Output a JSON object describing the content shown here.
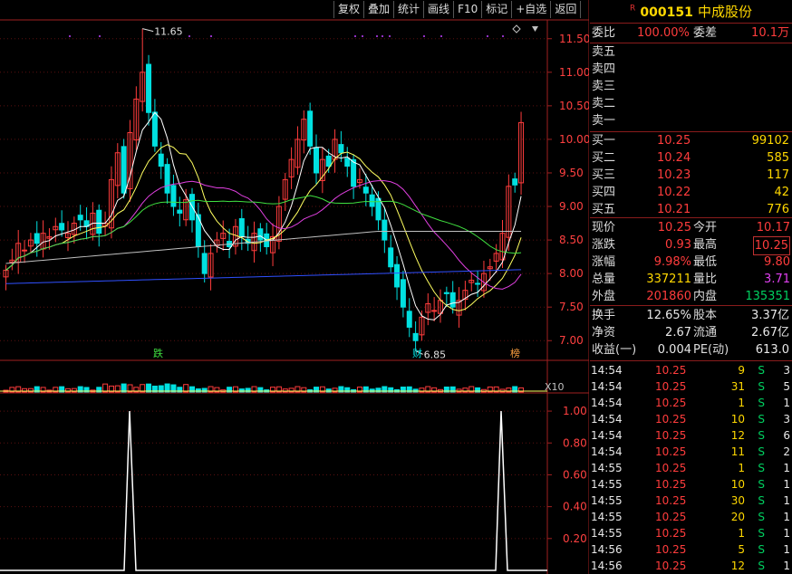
{
  "toolbar": {
    "buttons": [
      "复权",
      "叠加",
      "统计",
      "画线",
      "F10",
      "标记",
      "+自选",
      "返回"
    ]
  },
  "stock": {
    "flag": "R",
    "code": "000151",
    "name": "中成股份"
  },
  "weibi": {
    "label": "委比",
    "value": "100.00%",
    "label2": "委差",
    "value2": "10.1万"
  },
  "asks": [
    {
      "label": "卖五"
    },
    {
      "label": "卖四"
    },
    {
      "label": "卖三"
    },
    {
      "label": "卖二"
    },
    {
      "label": "卖一"
    }
  ],
  "bids": [
    {
      "label": "买一",
      "price": "10.25",
      "vol": "99102"
    },
    {
      "label": "买二",
      "price": "10.24",
      "vol": "585"
    },
    {
      "label": "买三",
      "price": "10.23",
      "vol": "117"
    },
    {
      "label": "买四",
      "price": "10.22",
      "vol": "42"
    },
    {
      "label": "买五",
      "price": "10.21",
      "vol": "776"
    }
  ],
  "quote": [
    {
      "l1": "现价",
      "v1": "10.25",
      "l2": "今开",
      "v2": "10.17"
    },
    {
      "l1": "涨跌",
      "v1": "0.93",
      "l2": "最高",
      "v2": "10.25"
    },
    {
      "l1": "涨幅",
      "v1": "9.98%",
      "l2": "最低",
      "v2": "9.80"
    },
    {
      "l1": "总量",
      "v1": "337211",
      "l2": "量比",
      "v2": "3.71"
    },
    {
      "l1": "外盘",
      "v1": "201860",
      "l2": "内盘",
      "v2": "135351"
    }
  ],
  "fund": [
    {
      "l1": "换手",
      "v1": "12.65%",
      "l2": "股本",
      "v2": "3.37亿"
    },
    {
      "l1": "净资",
      "v1": "2.67",
      "l2": "流通",
      "v2": "2.67亿"
    },
    {
      "l1": "收益(一)",
      "v1": "0.004",
      "l2": "PE(动)",
      "v2": "613.0"
    }
  ],
  "ticks": [
    {
      "time": "14:54",
      "price": "10.25",
      "vol": "9",
      "side": "S",
      "n": "3"
    },
    {
      "time": "14:54",
      "price": "10.25",
      "vol": "31",
      "side": "S",
      "n": "5"
    },
    {
      "time": "14:54",
      "price": "10.25",
      "vol": "1",
      "side": "S",
      "n": "1"
    },
    {
      "time": "14:54",
      "price": "10.25",
      "vol": "10",
      "side": "S",
      "n": "3"
    },
    {
      "time": "14:54",
      "price": "10.25",
      "vol": "12",
      "side": "S",
      "n": "6"
    },
    {
      "time": "14:54",
      "price": "10.25",
      "vol": "11",
      "side": "S",
      "n": "2"
    },
    {
      "time": "14:55",
      "price": "10.25",
      "vol": "1",
      "side": "S",
      "n": "1"
    },
    {
      "time": "14:55",
      "price": "10.25",
      "vol": "10",
      "side": "S",
      "n": "1"
    },
    {
      "time": "14:55",
      "price": "10.25",
      "vol": "30",
      "side": "S",
      "n": "1"
    },
    {
      "time": "14:55",
      "price": "10.25",
      "vol": "20",
      "side": "S",
      "n": "1"
    },
    {
      "time": "14:55",
      "price": "10.25",
      "vol": "1",
      "side": "S",
      "n": "1"
    },
    {
      "time": "14:56",
      "price": "10.25",
      "vol": "5",
      "side": "S",
      "n": "1"
    },
    {
      "time": "14:56",
      "price": "10.25",
      "vol": "12",
      "side": "S",
      "n": "1"
    }
  ],
  "chart": {
    "price_axis": [
      "11.50",
      "11.00",
      "10.50",
      "10.00",
      "9.50",
      "9.00",
      "8.50",
      "8.00",
      "7.50",
      "7.00"
    ],
    "price_range": [
      6.72,
      11.78
    ],
    "high_label": "11.65",
    "low_label": "6.85",
    "marker_die": "跌",
    "marker_cai": "财",
    "marker_bang": "榜",
    "vol_scale": "X10",
    "ind_axis": [
      "1.00",
      "0.80",
      "0.60",
      "0.40",
      "0.20"
    ],
    "colors": {
      "up": "#ff3c3c",
      "down": "#00e0e0",
      "ma5": "#ffffff",
      "ma10": "#ffff60",
      "ma20": "#e040e0",
      "ma30": "#40e040",
      "ma60": "#c0c0c0",
      "ma120": "#3050ff"
    }
  }
}
